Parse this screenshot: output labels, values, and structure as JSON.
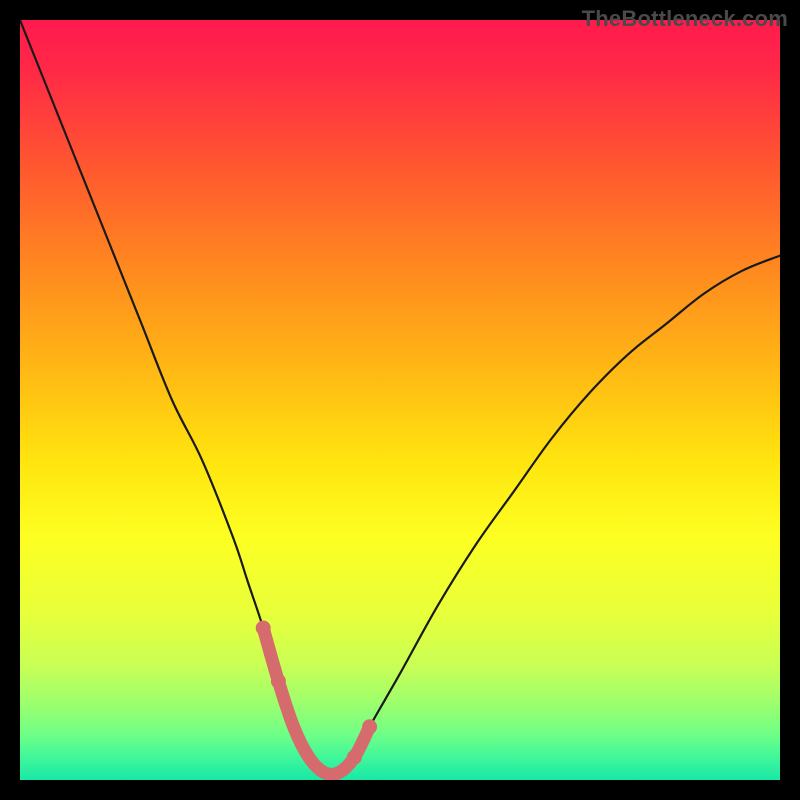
{
  "watermark": {
    "text": "TheBottleneck.com"
  },
  "colors": {
    "background": "#000000",
    "gradient_stops": [
      {
        "offset": 0.0,
        "color": "#ff1a4e"
      },
      {
        "offset": 0.07,
        "color": "#ff2a46"
      },
      {
        "offset": 0.2,
        "color": "#ff5a2e"
      },
      {
        "offset": 0.33,
        "color": "#ff8a1f"
      },
      {
        "offset": 0.46,
        "color": "#ffb814"
      },
      {
        "offset": 0.58,
        "color": "#ffe40f"
      },
      {
        "offset": 0.68,
        "color": "#fdff22"
      },
      {
        "offset": 0.78,
        "color": "#e8ff3a"
      },
      {
        "offset": 0.85,
        "color": "#c8ff55"
      },
      {
        "offset": 0.9,
        "color": "#9cff6e"
      },
      {
        "offset": 0.94,
        "color": "#6fff86"
      },
      {
        "offset": 0.97,
        "color": "#40f79a"
      },
      {
        "offset": 1.0,
        "color": "#18e8a6"
      }
    ],
    "curve_stroke": "#1a1a1a",
    "highlight_stroke": "#d66b6d"
  },
  "chart_data": {
    "type": "line",
    "title": "",
    "xlabel": "",
    "ylabel": "",
    "xlim": [
      0,
      100
    ],
    "ylim": [
      0,
      100
    ],
    "series": [
      {
        "name": "bottleneck-curve",
        "x": [
          0,
          4,
          8,
          12,
          16,
          20,
          24,
          28,
          30,
          32,
          34,
          36,
          38,
          40,
          42,
          44,
          46,
          50,
          55,
          60,
          65,
          70,
          75,
          80,
          85,
          90,
          95,
          100
        ],
        "values": [
          100,
          90,
          80,
          70,
          60,
          50,
          42,
          32,
          26,
          20,
          13,
          7,
          3,
          1,
          1,
          3,
          7,
          14,
          23,
          31,
          38,
          45,
          51,
          56,
          60,
          64,
          67,
          69
        ]
      },
      {
        "name": "optimal-range-highlight",
        "x": [
          32,
          34,
          36,
          38,
          40,
          42,
          44,
          46
        ],
        "values": [
          20,
          13,
          7,
          3,
          1,
          1,
          3,
          7
        ]
      }
    ],
    "notes": "V-shaped bottleneck curve over rainbow gradient; values estimated from pixel positions (0 = bottom/green, 100 = top/red). Optimal range ~x=36–44 highlighted in salmon."
  }
}
